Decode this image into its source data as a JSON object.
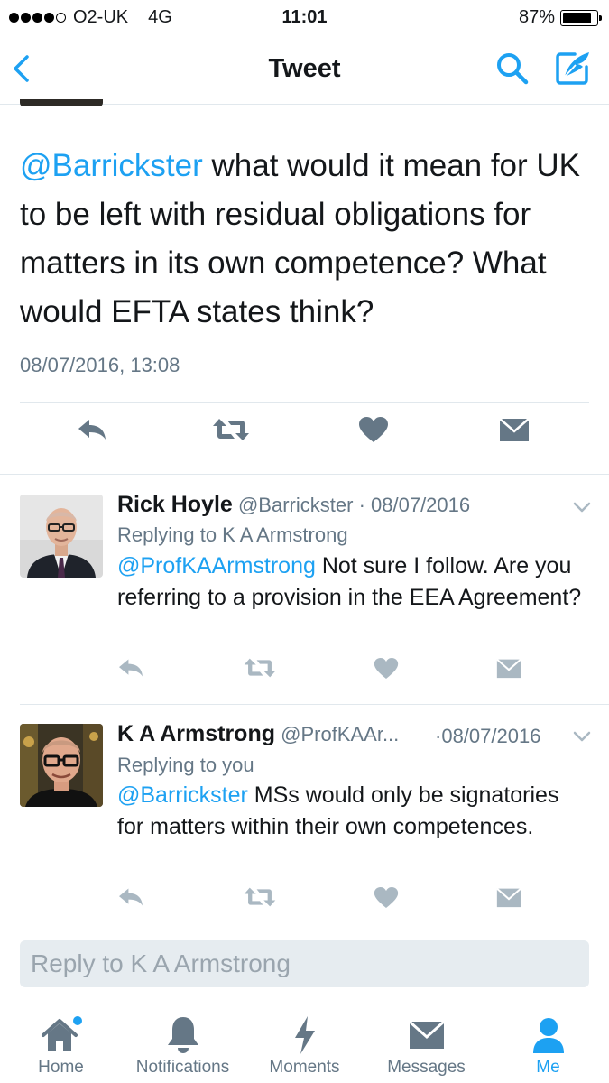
{
  "status_bar": {
    "carrier": "O2-UK",
    "network": "4G",
    "time": "11:01",
    "battery": "87%",
    "battery_level": 0.87
  },
  "nav": {
    "title": "Tweet",
    "accent_color": "#1da1f2"
  },
  "main_tweet": {
    "mention": "@Barrickster",
    "text": " what would it mean for UK to be left with residual obligations for matters in its own competence? What would EFTA states think?",
    "timestamp": "08/07/2016, 13:08"
  },
  "replies": [
    {
      "name": "Rick Hoyle",
      "handle": "@Barrickster",
      "separator": "·",
      "date": "08/07/2016",
      "replying_to": "Replying to K A Armstrong",
      "mention": "@ProfKAArmstrong",
      "text": " Not sure I follow. Are you referring to a provision in the EEA Agreement?"
    },
    {
      "name": "K A Armstrong",
      "handle": "@ProfKAAr...",
      "separator": "·",
      "date": "08/07/2016",
      "replying_to": "Replying to you",
      "mention": "@Barrickster",
      "text": " MSs would only be signatories for matters within their own competences."
    }
  ],
  "reply_box": {
    "placeholder": "Reply to K A Armstrong"
  },
  "tabs": [
    {
      "label": "Home",
      "icon": "home-icon"
    },
    {
      "label": "Notifications",
      "icon": "bell-icon"
    },
    {
      "label": "Moments",
      "icon": "lightning-icon"
    },
    {
      "label": "Messages",
      "icon": "envelope-icon"
    },
    {
      "label": "Me",
      "icon": "person-icon",
      "active": true
    }
  ]
}
